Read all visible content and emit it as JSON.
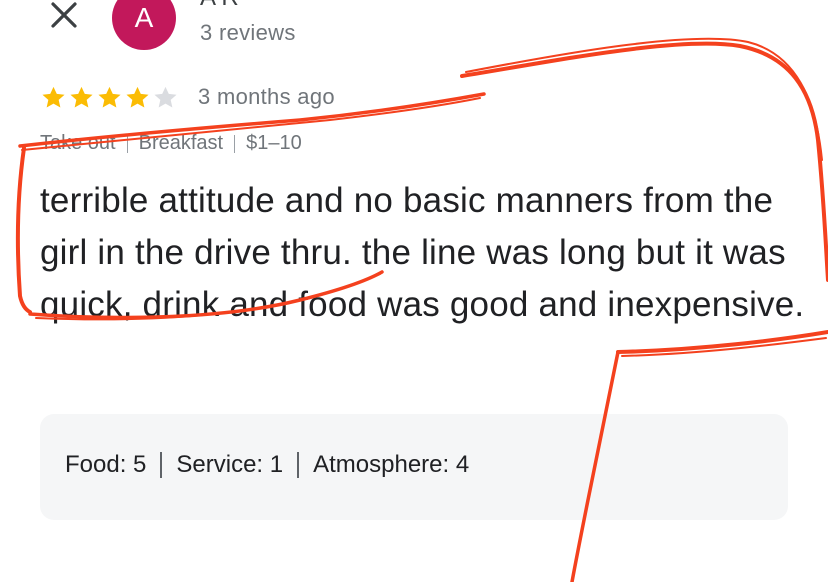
{
  "reviewer": {
    "avatar_letter": "A",
    "avatar_color": "#c2185b",
    "name": "A R",
    "review_count": "3 reviews"
  },
  "review": {
    "rating": 4,
    "max_rating": 5,
    "time": "3 months ago",
    "meta": {
      "service": "Take out",
      "meal": "Breakfast",
      "price": "$1–10"
    },
    "text": "terrible attitude and no basic manners from the girl in the drive thru. the line was long but it was quick, drink and food was good and inexpensive.",
    "aspect_ratings": [
      {
        "label": "Food:",
        "value": "5"
      },
      {
        "label": "Service:",
        "value": "1"
      },
      {
        "label": "Atmosphere:",
        "value": "4"
      }
    ]
  },
  "colors": {
    "star_filled": "#fbbc04",
    "star_empty": "#dadce0",
    "annotation": "#f4411e"
  },
  "icons": {
    "close": "close-icon",
    "star": "star-icon"
  }
}
